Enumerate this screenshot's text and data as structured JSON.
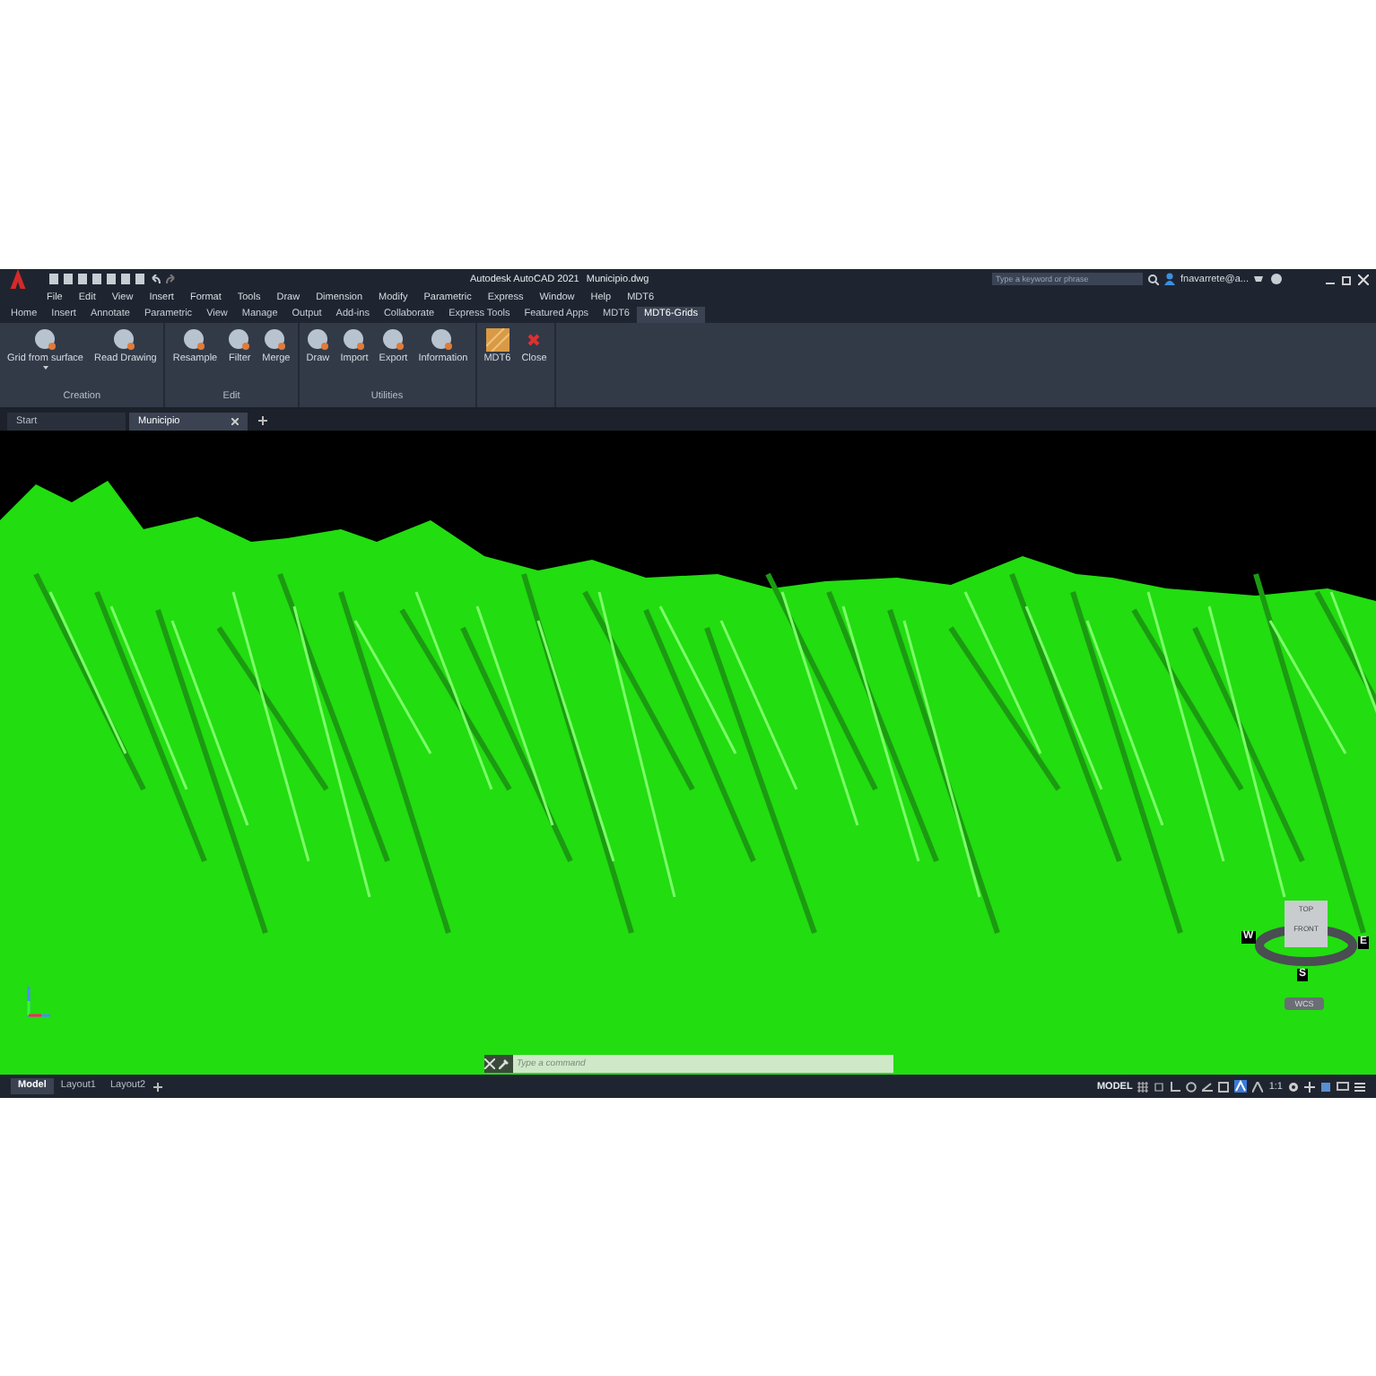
{
  "window": {
    "title": "Autodesk AutoCAD 2021",
    "file": "Municipio.dwg"
  },
  "search": {
    "placeholder": "Type a keyword or phrase"
  },
  "user": {
    "name": "fnavarrete@a..."
  },
  "menu": [
    "File",
    "Edit",
    "View",
    "Insert",
    "Format",
    "Tools",
    "Draw",
    "Dimension",
    "Modify",
    "Parametric",
    "Express",
    "Window",
    "Help",
    "MDT6"
  ],
  "ribbon_tabs": [
    {
      "label": "Home",
      "selected": false
    },
    {
      "label": "Insert",
      "selected": false
    },
    {
      "label": "Annotate",
      "selected": false
    },
    {
      "label": "Parametric",
      "selected": false
    },
    {
      "label": "View",
      "selected": false
    },
    {
      "label": "Manage",
      "selected": false
    },
    {
      "label": "Output",
      "selected": false
    },
    {
      "label": "Add-ins",
      "selected": false
    },
    {
      "label": "Collaborate",
      "selected": false
    },
    {
      "label": "Express Tools",
      "selected": false
    },
    {
      "label": "Featured Apps",
      "selected": false
    },
    {
      "label": "MDT6",
      "selected": false
    },
    {
      "label": "MDT6-Grids",
      "selected": true
    }
  ],
  "ribbon_groups": [
    {
      "label": "Creation",
      "buttons": [
        {
          "label": "Grid from surface",
          "kind": "sphere",
          "dropdown": true
        },
        {
          "label": "Read Drawing",
          "kind": "sphere",
          "dropdown": false
        }
      ]
    },
    {
      "label": "Edit",
      "buttons": [
        {
          "label": "Resample",
          "kind": "sphere",
          "dropdown": false
        },
        {
          "label": "Filter",
          "kind": "sphere",
          "dropdown": false
        },
        {
          "label": "Merge",
          "kind": "sphere",
          "dropdown": false
        }
      ]
    },
    {
      "label": "Utilities",
      "buttons": [
        {
          "label": "Draw",
          "kind": "sphere",
          "dropdown": false
        },
        {
          "label": "Import",
          "kind": "sphere",
          "dropdown": false
        },
        {
          "label": "Export",
          "kind": "sphere",
          "dropdown": false
        },
        {
          "label": "Information",
          "kind": "sphere",
          "dropdown": false
        }
      ]
    },
    {
      "buttons": [
        {
          "label": "MDT6",
          "kind": "texture",
          "dropdown": false
        },
        {
          "label": "Close",
          "kind": "close",
          "dropdown": false
        }
      ]
    }
  ],
  "document_tabs": [
    {
      "label": "Start",
      "selected": false,
      "closable": false
    },
    {
      "label": "Municipio",
      "selected": true,
      "closable": true
    }
  ],
  "viewcube": {
    "top": "TOP",
    "front": "FRONT",
    "directions": [
      "W",
      "E",
      "S"
    ],
    "ucs": "WCS"
  },
  "command_line": {
    "placeholder": "Type a command"
  },
  "layout_tabs": [
    {
      "label": "Model",
      "selected": true
    },
    {
      "label": "Layout1",
      "selected": false
    },
    {
      "label": "Layout2",
      "selected": false
    }
  ],
  "status_bar": {
    "mode": "MODEL",
    "scale": "1:1"
  }
}
